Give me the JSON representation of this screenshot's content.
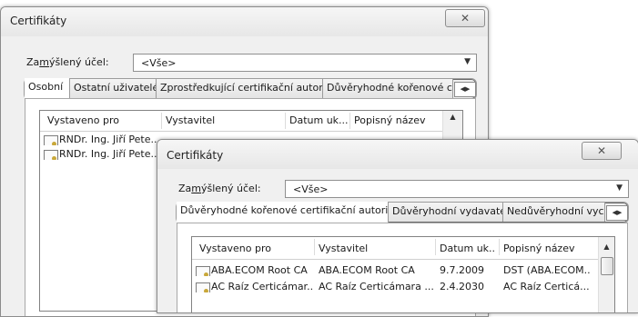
{
  "back_window": {
    "title": "Certifikáty",
    "close_icon": "close-icon",
    "purpose_label": "Zamýšlený účel:",
    "purpose_value": "<Vše>",
    "tabs": [
      "Osobní",
      "Ostatní uživatelé",
      "Zprostředkující certifikační autority",
      "Důvěryhodné kořenové ce"
    ],
    "columns": [
      "Vystaveno pro",
      "Vystavitel",
      "Datum uk...",
      "Popisný název"
    ],
    "rows": [
      {
        "issued_to": "RNDr. Ing. Jiří Pete..."
      },
      {
        "issued_to": "RNDr. Ing. Jiří Pete..."
      }
    ]
  },
  "front_window": {
    "title": "Certifikáty",
    "close_icon": "close-icon",
    "purpose_label": "Zamýšlený účel:",
    "purpose_value": "<Vše>",
    "tabs": [
      "Důvěryhodné kořenové certifikační autority",
      "Důvěryhodní vydavatelé",
      "Nedůvěryhodní vyc"
    ],
    "columns": [
      "Vystaveno pro",
      "Vystavitel",
      "Datum uk...",
      "Popisný název"
    ],
    "rows": [
      {
        "issued_to": "ABA.ECOM Root CA",
        "issuer": "ABA.ECOM Root CA",
        "date": "9.7.2009",
        "friendly": "DST (ABA.ECOM..."
      },
      {
        "issued_to": "AC Raíz Certicámar...",
        "issuer": "AC Raíz Certicámara ...",
        "date": "2.4.2030",
        "friendly": "AC Raíz Certicá..."
      }
    ]
  }
}
